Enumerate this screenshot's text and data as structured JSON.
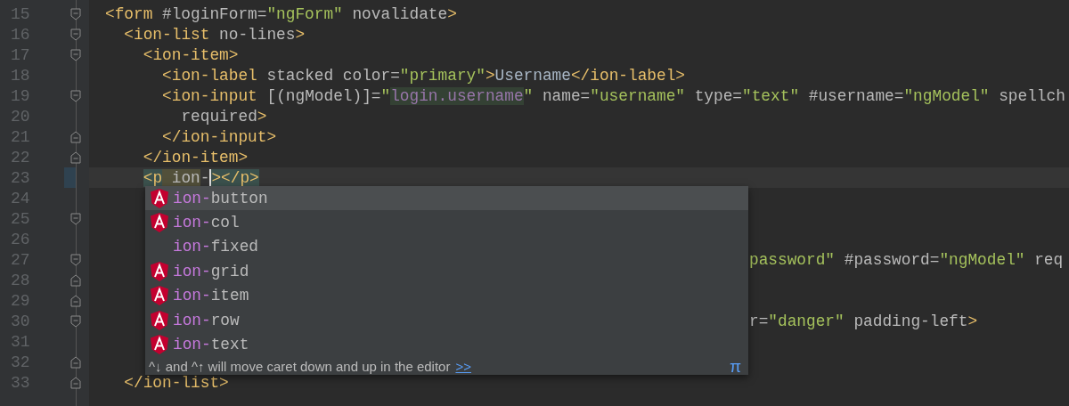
{
  "editor": {
    "lines": [
      {
        "number": "15",
        "fold_start": true,
        "fold_end": false,
        "current": false,
        "clipped": false,
        "tokens": [
          {
            "kind": "tag",
            "text": "<form"
          },
          {
            "kind": "attr",
            "text": " #loginForm="
          },
          {
            "kind": "str",
            "text": "\"ngForm\""
          },
          {
            "kind": "attr",
            "text": " novalidate"
          },
          {
            "kind": "tag",
            "text": ">"
          }
        ],
        "children": [
          {
            "number": "16",
            "fold_start": true,
            "fold_end": false,
            "current": false,
            "clipped": false,
            "tokens": [
              {
                "kind": "tag",
                "text": "<ion-list"
              },
              {
                "kind": "attr",
                "text": " no-lines"
              },
              {
                "kind": "tag",
                "text": ">"
              }
            ],
            "children": [
              {
                "number": "17",
                "fold_start": true,
                "fold_end": false,
                "current": false,
                "clipped": false,
                "tokens": [
                  {
                    "kind": "tag",
                    "text": "<ion-item>"
                  }
                ],
                "children": [
                  {
                    "number": "18",
                    "fold_start": false,
                    "fold_end": false,
                    "current": false,
                    "clipped": false,
                    "tokens": [
                      {
                        "kind": "tag",
                        "text": "<ion-label"
                      },
                      {
                        "kind": "attr",
                        "text": " stacked color="
                      },
                      {
                        "kind": "str",
                        "text": "\"primary\""
                      },
                      {
                        "kind": "tag",
                        "text": ">"
                      },
                      {
                        "kind": "text",
                        "text": "Username"
                      },
                      {
                        "kind": "tag",
                        "text": "</ion-label>"
                      }
                    ]
                  },
                  {
                    "number": "19",
                    "fold_start": true,
                    "fold_end": false,
                    "current": false,
                    "clipped": false,
                    "tokens": [
                      {
                        "kind": "tag",
                        "text": "<ion-input"
                      },
                      {
                        "kind": "attr",
                        "text": " [(ngModel)]="
                      },
                      {
                        "kind": "str",
                        "text": "\""
                      },
                      {
                        "kind": "expr",
                        "text": "login.username"
                      },
                      {
                        "kind": "str",
                        "text": "\""
                      },
                      {
                        "kind": "attr",
                        "text": " name="
                      },
                      {
                        "kind": "str",
                        "text": "\"username\""
                      },
                      {
                        "kind": "attr",
                        "text": " type="
                      },
                      {
                        "kind": "str",
                        "text": "\"text\""
                      },
                      {
                        "kind": "attr",
                        "text": " #username="
                      },
                      {
                        "kind": "str",
                        "text": "\"ngModel\""
                      },
                      {
                        "kind": "attr",
                        "text": " spellch"
                      }
                    ],
                    "children": [
                      {
                        "number": "20",
                        "fold_start": false,
                        "fold_end": false,
                        "current": false,
                        "clipped": false,
                        "tokens": [
                          {
                            "kind": "attr",
                            "text": "required"
                          },
                          {
                            "kind": "tag",
                            "text": ">"
                          }
                        ]
                      }
                    ]
                  },
                  {
                    "number": "21",
                    "fold_start": false,
                    "fold_end": true,
                    "current": false,
                    "clipped": false,
                    "tokens": [
                      {
                        "kind": "tag",
                        "text": "</ion-input>"
                      }
                    ]
                  }
                ]
              },
              {
                "number": "22",
                "fold_start": false,
                "fold_end": true,
                "current": false,
                "clipped": false,
                "tokens": [
                  {
                    "kind": "tag",
                    "text": "</ion-item>"
                  }
                ]
              },
              {
                "number": "23",
                "fold_start": false,
                "fold_end": false,
                "current": true,
                "clipped": false,
                "tokens": [
                  {
                    "kind": "match",
                    "text": "<p"
                  },
                  {
                    "kind": "typed",
                    "text": " ion"
                  },
                  {
                    "kind": "attr",
                    "text": "-"
                  },
                  {
                    "kind": "match",
                    "text": ">",
                    "caret": true
                  },
                  {
                    "kind": "match",
                    "text": "</p>"
                  }
                ]
              },
              {
                "number": "24",
                "fold_start": false,
                "fold_end": false,
                "current": false
              },
              {
                "number": "25",
                "fold_start": true,
                "fold_end": false,
                "current": false
              },
              {
                "number": "26",
                "fold_start": false,
                "fold_end": false,
                "current": false
              },
              {
                "number": "27",
                "fold_start": true,
                "fold_end": false,
                "current": false,
                "clipped": true,
                "tokens": [
                  {
                    "kind": "str",
                    "text": "password\""
                  },
                  {
                    "kind": "attr",
                    "text": " #password="
                  },
                  {
                    "kind": "str",
                    "text": "\"ngModel\""
                  },
                  {
                    "kind": "attr",
                    "text": " req"
                  }
                ]
              },
              {
                "number": "28",
                "fold_start": false,
                "fold_end": true,
                "current": false
              },
              {
                "number": "29",
                "fold_start": false,
                "fold_end": true,
                "current": false
              },
              {
                "number": "30",
                "fold_start": true,
                "fold_end": false,
                "current": false,
                "clipped": true,
                "tokens": [
                  {
                    "kind": "attr",
                    "text": "r="
                  },
                  {
                    "kind": "str",
                    "text": "\"danger\""
                  },
                  {
                    "kind": "attr",
                    "text": " padding-left"
                  },
                  {
                    "kind": "tag",
                    "text": ">"
                  }
                ]
              },
              {
                "number": "31",
                "fold_start": false,
                "fold_end": false,
                "current": false
              },
              {
                "number": "32",
                "fold_start": false,
                "fold_end": true,
                "current": false
              }
            ]
          },
          {
            "number": "33",
            "fold_start": false,
            "fold_end": true,
            "current": false,
            "clipped": false,
            "tokens": [
              {
                "kind": "tag",
                "text": "</ion-list>"
              }
            ]
          }
        ]
      }
    ]
  },
  "completion": {
    "items": [
      {
        "kind": "component",
        "matched": "ion-",
        "rest": "button",
        "selected": true
      },
      {
        "kind": "component",
        "matched": "ion-",
        "rest": "col",
        "selected": false
      },
      {
        "kind": "plain",
        "matched": "ion-",
        "rest": "fixed",
        "selected": false
      },
      {
        "kind": "component",
        "matched": "ion-",
        "rest": "grid",
        "selected": false
      },
      {
        "kind": "component",
        "matched": "ion-",
        "rest": "item",
        "selected": false
      },
      {
        "kind": "component",
        "matched": "ion-",
        "rest": "row",
        "selected": false
      },
      {
        "kind": "component",
        "matched": "ion-",
        "rest": "text",
        "selected": false
      }
    ],
    "hint": "^↓ and ^↑ will move caret down and up in the editor",
    "link": ">>",
    "pi": "π"
  }
}
